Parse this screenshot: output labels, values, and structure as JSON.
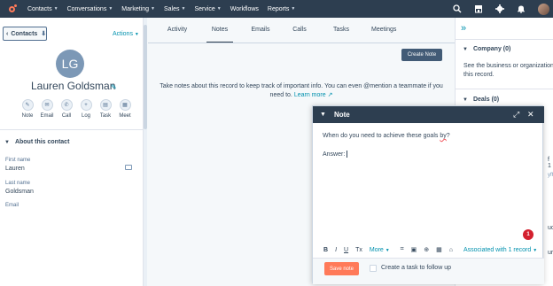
{
  "colors": {
    "nav_bg": "#2d3e50",
    "accent": "#0091ae",
    "orange": "#ff7a59",
    "badge_red": "#d3202e"
  },
  "topnav": {
    "logo_icon": "hubspot-sprocket-icon",
    "items": [
      {
        "label": "Contacts"
      },
      {
        "label": "Conversations"
      },
      {
        "label": "Marketing"
      },
      {
        "label": "Sales"
      },
      {
        "label": "Service"
      },
      {
        "label": "Workflows"
      },
      {
        "label": "Reports"
      }
    ],
    "right_icons": [
      "search-icon",
      "marketplace-icon",
      "settings-icon",
      "notifications-icon",
      "user-avatar"
    ]
  },
  "left": {
    "back_label": "Contacts",
    "actions_label": "Actions",
    "avatar_initials": "LG",
    "contact_name": "Lauren Goldsman",
    "actions": [
      {
        "label": "Note",
        "icon": "note-icon"
      },
      {
        "label": "Email",
        "icon": "email-icon"
      },
      {
        "label": "Call",
        "icon": "phone-icon"
      },
      {
        "label": "Log",
        "icon": "plus-icon"
      },
      {
        "label": "Task",
        "icon": "task-icon"
      },
      {
        "label": "Meet",
        "icon": "calendar-icon"
      }
    ],
    "about_header": "About this contact",
    "fields": [
      {
        "label": "First name",
        "value": "Lauren"
      },
      {
        "label": "Last name",
        "value": "Goldsman"
      },
      {
        "label": "Email",
        "value": ""
      }
    ]
  },
  "center": {
    "tabs": [
      {
        "label": "Activity",
        "active": false
      },
      {
        "label": "Notes",
        "active": true
      },
      {
        "label": "Emails",
        "active": false
      },
      {
        "label": "Calls",
        "active": false
      },
      {
        "label": "Tasks",
        "active": false
      },
      {
        "label": "Meetings",
        "active": false
      }
    ],
    "create_note_label": "Create Note",
    "info_text": "Take notes about this record to keep track of important info. You can even @mention a teammate if you need to.",
    "learn_more": "Learn more"
  },
  "right": {
    "company_header": "Company (0)",
    "company_text_1": "See the business or organization as",
    "company_text_2": "this record.",
    "deals_header": "Deals (0)",
    "peeks": [
      "f 1",
      "yfhb",
      "uoth",
      "ure"
    ]
  },
  "note_dialog": {
    "title": "Note",
    "line1_prefix": "When do you need to achieve these goals ",
    "line1_misspelled": "by",
    "line1_suffix": "?",
    "line2": "Answer:",
    "badge_count": "1",
    "toolbar": [
      "B",
      "I",
      "U",
      "Tx",
      "More",
      "⌗",
      "▣",
      "⊕",
      "▦",
      "⌂"
    ],
    "more_label": "More",
    "association_label": "Associated with 1 record",
    "save_label": "Save note",
    "task_label": "Create a task to follow up"
  }
}
